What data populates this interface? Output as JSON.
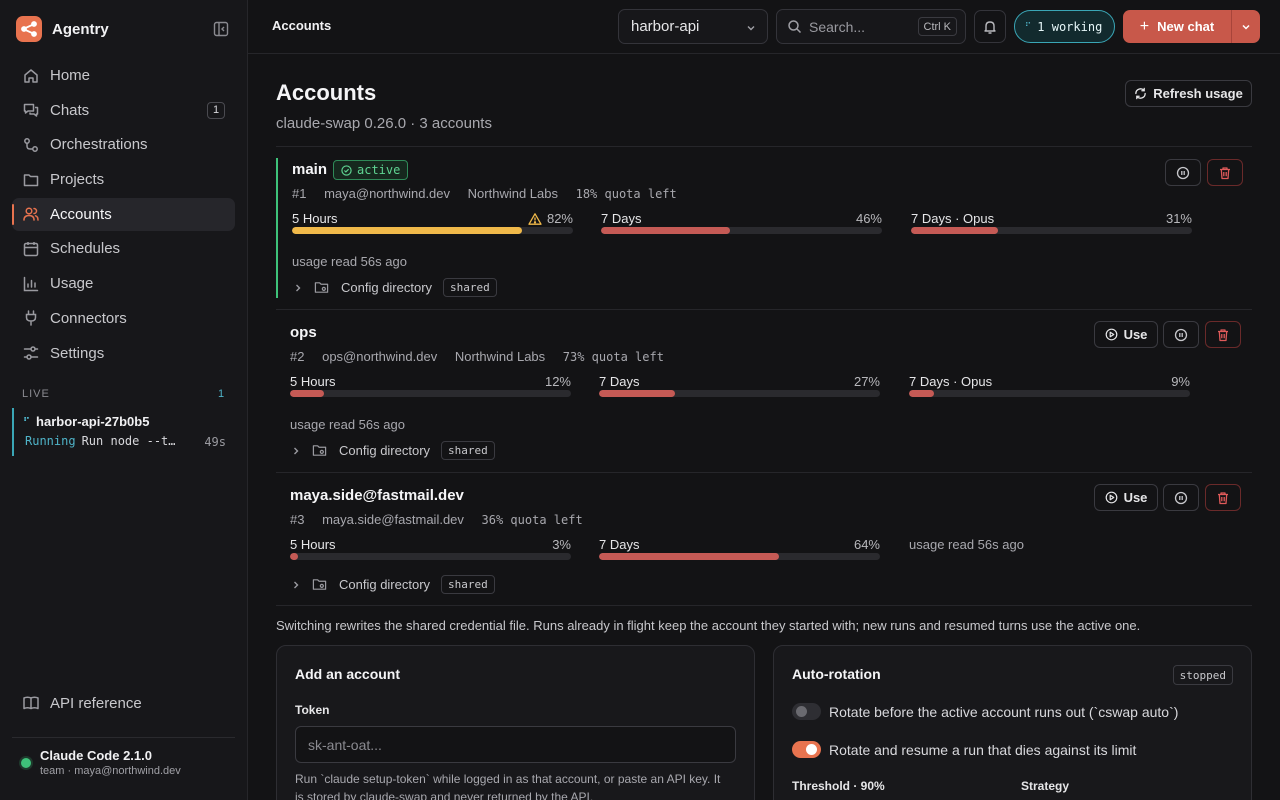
{
  "app": {
    "name": "Agentry"
  },
  "sidebar": {
    "items": [
      {
        "label": "Home",
        "icon": "home-icon"
      },
      {
        "label": "Chats",
        "icon": "chat-icon",
        "badge": "1"
      },
      {
        "label": "Orchestrations",
        "icon": "orchestration-icon"
      },
      {
        "label": "Projects",
        "icon": "folder-icon"
      },
      {
        "label": "Accounts",
        "icon": "users-icon",
        "active": true
      },
      {
        "label": "Schedules",
        "icon": "calendar-icon"
      },
      {
        "label": "Usage",
        "icon": "chart-icon"
      },
      {
        "label": "Connectors",
        "icon": "plug-icon"
      },
      {
        "label": "Settings",
        "icon": "sliders-icon"
      }
    ],
    "live": {
      "label": "LIVE",
      "count": "1",
      "run": {
        "name": "harbor-api-27b0b5",
        "status": "Running",
        "command": "Run node --test",
        "elapsed": "49s"
      }
    },
    "api_reference": "API reference",
    "footer": {
      "version": "Claude Code 2.1.0",
      "account": "team · maya@northwind.dev"
    }
  },
  "topbar": {
    "breadcrumb": "Accounts",
    "project": "harbor-api",
    "search_placeholder": "Search...",
    "search_shortcut": "Ctrl K",
    "working": "1 working",
    "new_chat": "New chat"
  },
  "main": {
    "title": "Accounts",
    "subtitle": "claude-swap 0.26.0 · 3 accounts",
    "refresh_label": "Refresh usage",
    "use_label": "Use",
    "config_label": "Config directory",
    "shared_label": "shared",
    "accounts": [
      {
        "name": "main",
        "active": true,
        "active_label": "active",
        "index": "#1",
        "email": "maya@northwind.dev",
        "org": "Northwind Labs",
        "quota": "18% quota left",
        "meters": [
          {
            "label": "5 Hours",
            "pct": "82%",
            "value": 82,
            "warn": true,
            "color": "#f0b94a"
          },
          {
            "label": "7 Days",
            "pct": "46%",
            "value": 46,
            "color": "#c55a55"
          },
          {
            "label": "7 Days · Opus",
            "pct": "31%",
            "value": 31,
            "color": "#c55a55"
          }
        ],
        "usage_read": "usage read 56s ago"
      },
      {
        "name": "ops",
        "active": false,
        "index": "#2",
        "email": "ops@northwind.dev",
        "org": "Northwind Labs",
        "quota": "73% quota left",
        "meters": [
          {
            "label": "5 Hours",
            "pct": "12%",
            "value": 12,
            "color": "#c55a55"
          },
          {
            "label": "7 Days",
            "pct": "27%",
            "value": 27,
            "color": "#c55a55"
          },
          {
            "label": "7 Days · Opus",
            "pct": "9%",
            "value": 9,
            "color": "#c55a55"
          }
        ],
        "usage_read": "usage read 56s ago"
      },
      {
        "name": "maya.side@fastmail.dev",
        "active": false,
        "index": "#3",
        "email": "maya.side@fastmail.dev",
        "quota": "36% quota left",
        "meters": [
          {
            "label": "5 Hours",
            "pct": "3%",
            "value": 3,
            "color": "#c55a55"
          },
          {
            "label": "7 Days",
            "pct": "64%",
            "value": 64,
            "color": "#c55a55"
          }
        ],
        "usage_read": "usage read 56s ago"
      }
    ],
    "note": "Switching rewrites the shared credential file. Runs already in flight keep the account they started with; new runs and resumed turns use the active one.",
    "add_account": {
      "title": "Add an account",
      "token_label": "Token",
      "token_placeholder": "sk-ant-oat...",
      "help": "Run `claude setup-token` while logged in as that account, or paste an API key. It is stored by claude-swap and never returned by the API."
    },
    "auto_rotation": {
      "title": "Auto-rotation",
      "status": "stopped",
      "option1": "Rotate before the active account runs out (`cswap auto`)",
      "option1_on": false,
      "option2": "Rotate and resume a run that dies against its limit",
      "option2_on": true,
      "threshold_label": "Threshold · 90%",
      "strategy_label": "Strategy"
    }
  },
  "colors": {
    "accent": "#e8734f",
    "active": "#3ec27a",
    "live": "#4fb3c8",
    "danger": "#e05a5a",
    "warn": "#f0b94a"
  }
}
